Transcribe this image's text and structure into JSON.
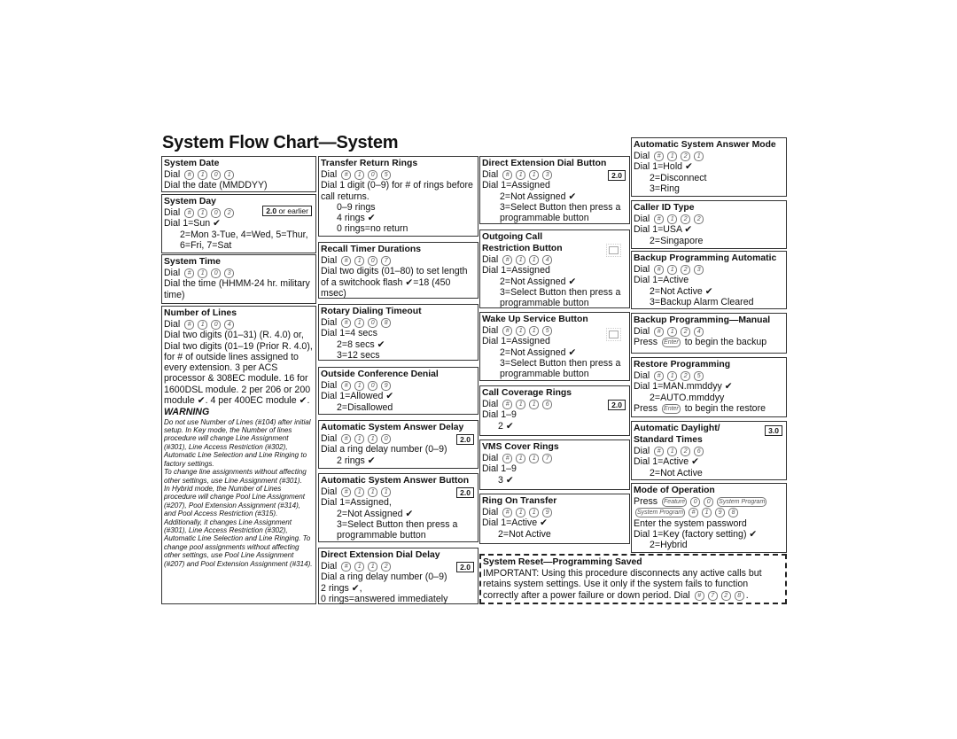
{
  "page_title": "System Flow Chart—System",
  "icons": {
    "check": "check-mark-icon",
    "lamp": "button-lamp-icon",
    "key": "dial-key-icon"
  },
  "boxes": [
    {
      "title": "System Date",
      "lines": [
        {
          "s": [
            "Dial ",
            {
              "k": "#"
            },
            {
              "k": "1"
            },
            {
              "k": "0"
            },
            {
              "k": "1"
            }
          ]
        },
        {
          "s": [
            "Dial the date (MMDDYY)"
          ]
        }
      ]
    },
    {
      "title": "System Day",
      "badge": {
        "bold": "2.0",
        "rest": " or earlier"
      },
      "lines": [
        {
          "s": [
            "Dial ",
            {
              "k": "#"
            },
            {
              "k": "1"
            },
            {
              "k": "0"
            },
            {
              "k": "2"
            }
          ]
        },
        {
          "s": [
            "Dial 1=Sun ✔"
          ]
        },
        {
          "i": 1,
          "w": true,
          "s": [
            "2=Mon 3-Tue, 4=Wed, 5=Thur, 6=Fri, 7=Sat"
          ]
        }
      ]
    },
    {
      "title": "System Time",
      "lines": [
        {
          "s": [
            "Dial ",
            {
              "k": "#"
            },
            {
              "k": "1"
            },
            {
              "k": "0"
            },
            {
              "k": "3"
            }
          ]
        },
        {
          "w": true,
          "s": [
            "Dial the time (HHMM-24 hr. military time)"
          ]
        }
      ]
    },
    {
      "title": "Number of Lines",
      "lines": [
        {
          "s": [
            "Dial ",
            {
              "k": "#"
            },
            {
              "k": "1"
            },
            {
              "k": "0"
            },
            {
              "k": "4"
            }
          ]
        },
        {
          "w": true,
          "s": [
            "Dial two digits (01–31) (R. 4.0) or, Dial two digits (01–19 (Prior R. 4.0), for # of outside lines assigned to every extension. 3 per ACS processor & 308EC module. 16 for 1600DSL module. 2 per 206 or 200 module ✔. 4 per 400EC module ✔."
          ]
        }
      ],
      "warning": {
        "heading": "WARNING",
        "paragraphs": [
          "Do not use Number of Lines (#104) after initial setup. In Key mode, the Number of lines procedure will change Line Assignment (#301), Line Access Restriction (#302), Automatic Line Selection and Line Ringing to factory settings.",
          "To change line assignments without affecting other settings, use Line Assignment (#301).",
          "In Hybrid mode, the Number of Lines procedure will change Pool Line Assignment (#207), Pool Extension Assignment (#314), and Pool Access Restriction (#315). Additionally, it changes Line Assignment (#301), Line Access Restriction (#302), Automatic Line Selection and Line Ringing. To change pool assignments without affecting other settings, use Pool Line Assignment (#207) and Pool Extension Assignment (#314)."
        ]
      }
    },
    {
      "title": "Transfer Return Rings",
      "lines": [
        {
          "s": [
            "Dial ",
            {
              "k": "#"
            },
            {
              "k": "1"
            },
            {
              "k": "0"
            },
            {
              "k": "5"
            }
          ]
        },
        {
          "w": true,
          "s": [
            "Dial 1 digit (0–9) for # of rings before call returns."
          ]
        },
        {
          "i": 1,
          "s": [
            "0–9 rings"
          ]
        },
        {
          "i": 1,
          "s": [
            "4 rings ✔"
          ]
        },
        {
          "i": 1,
          "s": [
            "0 rings=no return"
          ]
        }
      ]
    },
    {
      "title": "Recall Timer Durations",
      "lines": [
        {
          "s": [
            "Dial ",
            {
              "k": "#"
            },
            {
              "k": "1"
            },
            {
              "k": "0"
            },
            {
              "k": "7"
            }
          ]
        },
        {
          "w": true,
          "s": [
            "Dial two digits (01–80) to set length of a switchook flash ✔=18 (450 msec)"
          ]
        }
      ]
    },
    {
      "title": "Rotary Dialing Timeout",
      "lines": [
        {
          "s": [
            "Dial ",
            {
              "k": "#"
            },
            {
              "k": "1"
            },
            {
              "k": "0"
            },
            {
              "k": "8"
            }
          ]
        },
        {
          "s": [
            "Dial 1=4 secs"
          ]
        },
        {
          "i": 1,
          "s": [
            "2=8 secs ✔"
          ]
        },
        {
          "i": 1,
          "s": [
            "3=12 secs"
          ]
        }
      ]
    },
    {
      "title": "Outside Conference Denial",
      "lines": [
        {
          "s": [
            "Dial ",
            {
              "k": "#"
            },
            {
              "k": "1"
            },
            {
              "k": "0"
            },
            {
              "k": "9"
            }
          ]
        },
        {
          "s": [
            "Dial 1=Allowed ✔"
          ]
        },
        {
          "i": 1,
          "s": [
            "2=Disallowed"
          ]
        }
      ]
    },
    {
      "title": "Automatic System Answer Delay",
      "badge": {
        "bold": "2.0"
      },
      "lines": [
        {
          "s": [
            "Dial ",
            {
              "k": "#"
            },
            {
              "k": "1"
            },
            {
              "k": "1"
            },
            {
              "k": "0"
            }
          ]
        },
        {
          "s": [
            "Dial a ring delay number (0–9)"
          ]
        },
        {
          "i": 1,
          "s": [
            "2 rings ✔"
          ]
        }
      ]
    },
    {
      "title": "Automatic System Answer Button",
      "badge": {
        "bold": "2.0"
      },
      "lines": [
        {
          "s": [
            "Dial ",
            {
              "k": "#"
            },
            {
              "k": "1"
            },
            {
              "k": "1"
            },
            {
              "k": "1"
            }
          ]
        },
        {
          "s": [
            "Dial 1=Assigned,"
          ]
        },
        {
          "i": 1,
          "s": [
            "2=Not Assigned ✔"
          ]
        },
        {
          "i": 1,
          "s": [
            "3=Select Button then press a"
          ]
        },
        {
          "i": 1,
          "s": [
            "programmable button"
          ]
        }
      ]
    },
    {
      "title": "Direct Extension Dial Delay",
      "badge": {
        "bold": "2.0"
      },
      "lines": [
        {
          "s": [
            "Dial ",
            {
              "k": "#"
            },
            {
              "k": "1"
            },
            {
              "k": "1"
            },
            {
              "k": "2"
            }
          ]
        },
        {
          "s": [
            "Dial a ring delay number (0–9)"
          ]
        },
        {
          "s": [
            "2 rings ✔,"
          ]
        },
        {
          "s": [
            "0 rings=answered immediately"
          ]
        }
      ]
    },
    {
      "title": "Direct Extension Dial Button",
      "badge": {
        "bold": "2.0"
      },
      "lines": [
        {
          "s": [
            "Dial ",
            {
              "k": "#"
            },
            {
              "k": "1"
            },
            {
              "k": "1"
            },
            {
              "k": "3"
            }
          ]
        },
        {
          "s": [
            "Dial 1=Assigned"
          ]
        },
        {
          "i": 2,
          "s": [
            "2=Not Assigned ✔"
          ]
        },
        {
          "i": 2,
          "s": [
            "3=Select Button then press a"
          ]
        },
        {
          "i": 2,
          "s": [
            "programmable button"
          ]
        }
      ]
    },
    {
      "title": "Outgoing Call",
      "title2": "Restriction Button",
      "lamp": true,
      "lines": [
        {
          "s": [
            "Dial ",
            {
              "k": "#"
            },
            {
              "k": "1"
            },
            {
              "k": "1"
            },
            {
              "k": "4"
            }
          ]
        },
        {
          "s": [
            "Dial 1=Assigned"
          ]
        },
        {
          "i": 2,
          "s": [
            "2=Not Assigned ✔"
          ]
        },
        {
          "i": 2,
          "s": [
            "3=Select Button then press a"
          ]
        },
        {
          "i": 2,
          "s": [
            "programmable button"
          ]
        }
      ]
    },
    {
      "title": "Wake Up Service Button",
      "lamp": true,
      "lines": [
        {
          "s": [
            "Dial ",
            {
              "k": "#"
            },
            {
              "k": "1"
            },
            {
              "k": "1"
            },
            {
              "k": "5"
            }
          ]
        },
        {
          "s": [
            "Dial 1=Assigned"
          ]
        },
        {
          "i": 2,
          "s": [
            "2=Not Assigned ✔"
          ]
        },
        {
          "i": 2,
          "s": [
            "3=Select Button then press a"
          ]
        },
        {
          "i": 2,
          "s": [
            "programmable button"
          ]
        }
      ]
    },
    {
      "title": "Call Coverage Rings",
      "badge": {
        "bold": "2.0"
      },
      "lines": [
        {
          "s": [
            "Dial ",
            {
              "k": "#"
            },
            {
              "k": "1"
            },
            {
              "k": "1"
            },
            {
              "k": "6"
            }
          ]
        },
        {
          "s": [
            "Dial 1–9"
          ]
        },
        {
          "i": 1,
          "s": [
            "2 ✔"
          ]
        }
      ]
    },
    {
      "title": "VMS Cover Rings",
      "lines": [
        {
          "s": [
            "Dial ",
            {
              "k": "#"
            },
            {
              "k": "1"
            },
            {
              "k": "1"
            },
            {
              "k": "7"
            }
          ]
        },
        {
          "s": [
            "Dial 1–9"
          ]
        },
        {
          "i": 1,
          "s": [
            "3 ✔"
          ]
        }
      ]
    },
    {
      "title": "Ring On Transfer",
      "lines": [
        {
          "s": [
            "Dial ",
            {
              "k": "#"
            },
            {
              "k": "1"
            },
            {
              "k": "1"
            },
            {
              "k": "9"
            }
          ]
        },
        {
          "s": [
            "Dial 1=Active ✔"
          ]
        },
        {
          "i": 1,
          "s": [
            "2=Not Active"
          ]
        }
      ]
    },
    {
      "title": "Automatic System Answer Mode",
      "lines": [
        {
          "s": [
            "Dial ",
            {
              "k": "#"
            },
            {
              "k": "1"
            },
            {
              "k": "2"
            },
            {
              "k": "1"
            }
          ]
        },
        {
          "s": [
            "Dial 1=Hold ✔"
          ]
        },
        {
          "i": 1,
          "s": [
            "2=Disconnect"
          ]
        },
        {
          "i": 1,
          "s": [
            "3=Ring"
          ]
        }
      ]
    },
    {
      "title": "Caller ID Type",
      "lines": [
        {
          "s": [
            "Dial ",
            {
              "k": "#"
            },
            {
              "k": "1"
            },
            {
              "k": "2"
            },
            {
              "k": "2"
            }
          ]
        },
        {
          "s": [
            "Dial 1=USA ✔"
          ]
        },
        {
          "i": 1,
          "s": [
            "2=Singapore"
          ]
        }
      ]
    },
    {
      "title": "Backup Programming Automatic",
      "lines": [
        {
          "s": [
            "Dial ",
            {
              "k": "#"
            },
            {
              "k": "1"
            },
            {
              "k": "2"
            },
            {
              "k": "3"
            }
          ]
        },
        {
          "s": [
            "Dial 1=Active"
          ]
        },
        {
          "i": 1,
          "s": [
            "2=Not Active ✔"
          ]
        },
        {
          "i": 1,
          "s": [
            "3=Backup Alarm Cleared"
          ]
        }
      ]
    },
    {
      "title": "Backup Programming—Manual",
      "lines": [
        {
          "s": [
            "Dial ",
            {
              "k": "#"
            },
            {
              "k": "1"
            },
            {
              "k": "2"
            },
            {
              "k": "4"
            }
          ]
        },
        {
          "s": [
            "Press ",
            {
              "k": "Enter"
            },
            " to begin the backup"
          ]
        }
      ]
    },
    {
      "title": "Restore Programming",
      "lines": [
        {
          "s": [
            "Dial ",
            {
              "k": "#"
            },
            {
              "k": "1"
            },
            {
              "k": "2"
            },
            {
              "k": "5"
            }
          ]
        },
        {
          "s": [
            "Dial 1=MAN.mmddyy ✔"
          ]
        },
        {
          "i": 1,
          "s": [
            "2=AUTO.mmddyy"
          ]
        },
        {
          "s": [
            "Press ",
            {
              "k": "Enter"
            },
            " to begin the restore"
          ]
        }
      ]
    },
    {
      "title": "Automatic Daylight/",
      "title2": "Standard Times",
      "badge": {
        "bold": "3.0"
      },
      "lines": [
        {
          "s": [
            "Dial ",
            {
              "k": "#"
            },
            {
              "k": "1"
            },
            {
              "k": "2"
            },
            {
              "k": "6"
            }
          ]
        },
        {
          "s": [
            "Dial 1=Active ✔"
          ]
        },
        {
          "i": 1,
          "s": [
            "2=Not Active"
          ]
        }
      ]
    },
    {
      "title": "Mode of Operation",
      "lines": [
        {
          "s": [
            "Press ",
            {
              "k": "Feature"
            },
            {
              "k": "0"
            },
            {
              "k": "0"
            },
            {
              "k": "System Program"
            }
          ]
        },
        {
          "s": [
            {
              "k": "System Program"
            },
            {
              "k": "#"
            },
            {
              "k": "1"
            },
            {
              "k": "9"
            },
            {
              "k": "8"
            }
          ]
        },
        {
          "s": [
            "Enter the system password"
          ]
        },
        {
          "s": [
            "Dial 1=Key (factory setting) ✔"
          ]
        },
        {
          "i": 1,
          "s": [
            "2=Hybrid"
          ]
        }
      ]
    },
    {
      "title": "System Reset—Programming Saved",
      "dashed": true,
      "lines": [
        {
          "w": true,
          "s": [
            "IMPORTANT: Using this procedure disconnects any active calls but retains system settings. Use it only if the system fails to function correctly after a power failure or down period. Dial ",
            {
              "k": "#"
            },
            {
              "k": "7"
            },
            {
              "k": "2"
            },
            {
              "k": "8"
            },
            "."
          ]
        }
      ]
    }
  ]
}
